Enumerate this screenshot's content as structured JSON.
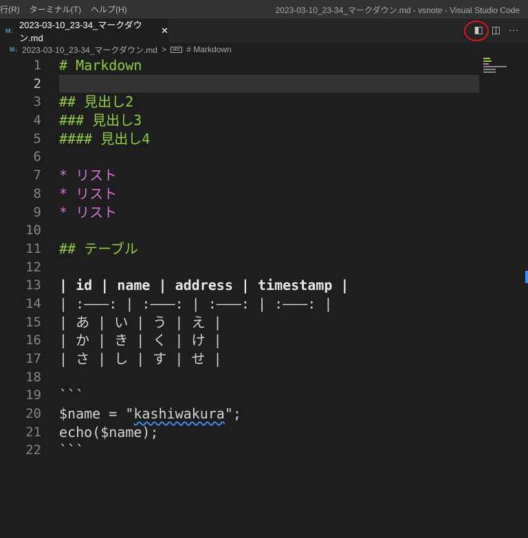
{
  "menu": [
    "行(R)",
    "ターミナル(T)",
    "ヘルプ(H)"
  ],
  "window_title": "2023-03-10_23-34_マークダウン.md - vsnote - Visual Studio Code",
  "tab": {
    "icon": "M↓",
    "label": "2023-03-10_23-34_マークダウン.md",
    "close": "✕"
  },
  "breadcrumb": {
    "file": "2023-03-10_23-34_マークダウン.md",
    "sep": ">",
    "symbol": "# Markdown"
  },
  "lines": [
    {
      "n": "1",
      "t": "# Markdown",
      "c": "h"
    },
    {
      "n": "2",
      "t": "",
      "c": ""
    },
    {
      "n": "3",
      "t": "## 見出し2",
      "c": "h"
    },
    {
      "n": "4",
      "t": "### 見出し3",
      "c": "h"
    },
    {
      "n": "5",
      "t": "#### 見出し4",
      "c": "h"
    },
    {
      "n": "6",
      "t": "",
      "c": ""
    },
    {
      "n": "7",
      "t": "* リスト",
      "c": "li"
    },
    {
      "n": "8",
      "t": "* リスト",
      "c": "li"
    },
    {
      "n": "9",
      "t": "* リスト",
      "c": "li"
    },
    {
      "n": "10",
      "t": "",
      "c": ""
    },
    {
      "n": "11",
      "t": "## テーブル",
      "c": "h"
    },
    {
      "n": "12",
      "t": "",
      "c": ""
    },
    {
      "n": "13",
      "t": "| id | name | address | timestamp |",
      "c": "tb"
    },
    {
      "n": "14",
      "t": "| :———: | :———: | :———: | :———: |",
      "c": ""
    },
    {
      "n": "15",
      "t": "| あ | い | う | え |",
      "c": ""
    },
    {
      "n": "16",
      "t": "| か | き | く | け |",
      "c": ""
    },
    {
      "n": "17",
      "t": "| さ | し | す | せ |",
      "c": ""
    },
    {
      "n": "18",
      "t": "",
      "c": ""
    },
    {
      "n": "19",
      "t": "```",
      "c": ""
    },
    {
      "n": "20",
      "t": "$name = \"kashiwakura\";",
      "c": "sq"
    },
    {
      "n": "21",
      "t": "echo($name);",
      "c": ""
    },
    {
      "n": "22",
      "t": "```",
      "c": ""
    }
  ]
}
